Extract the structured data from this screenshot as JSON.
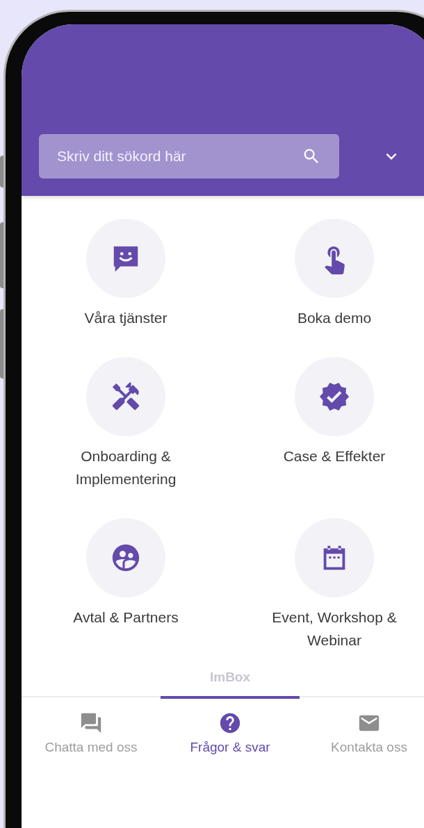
{
  "search": {
    "placeholder": "Skriv ditt sökord här"
  },
  "categories": [
    {
      "label": "Våra tjänster"
    },
    {
      "label": "Boka demo"
    },
    {
      "label": "Onboarding & Implementering"
    },
    {
      "label": "Case & Effekter"
    },
    {
      "label": "Avtal & Partners"
    },
    {
      "label": "Event, Workshop & Webinar"
    }
  ],
  "brand": "ImBox",
  "tabs": [
    {
      "label": "Chatta med oss",
      "selected": false
    },
    {
      "label": "Frågor & svar",
      "selected": true
    },
    {
      "label": "Kontakta oss",
      "selected": false
    }
  ]
}
